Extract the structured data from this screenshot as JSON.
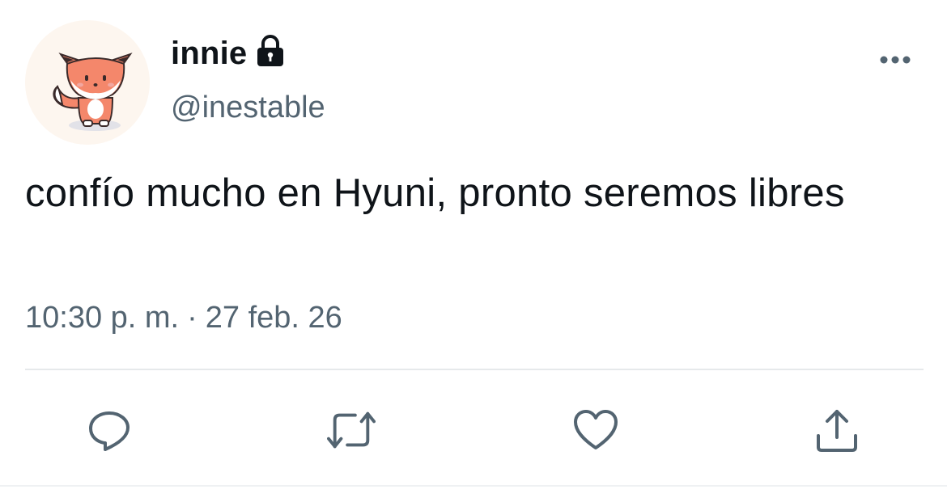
{
  "user": {
    "display_name": "innie",
    "handle": "@inestable",
    "protected_icon": "lock-icon",
    "avatar": "fox-avatar"
  },
  "tweet": {
    "text": "confío mucho en Hyuni, pronto seremos libres",
    "time": "10:30 p. m.",
    "separator": "·",
    "date": "27 feb. 26"
  },
  "actions": [
    {
      "name": "reply",
      "icon": "reply-icon"
    },
    {
      "name": "retweet",
      "icon": "retweet-icon"
    },
    {
      "name": "like",
      "icon": "heart-icon"
    },
    {
      "name": "share",
      "icon": "share-icon"
    }
  ],
  "colors": {
    "text": "#0f1419",
    "secondary": "#536471",
    "icon": "#536471",
    "divider": "#e6e9eb"
  }
}
